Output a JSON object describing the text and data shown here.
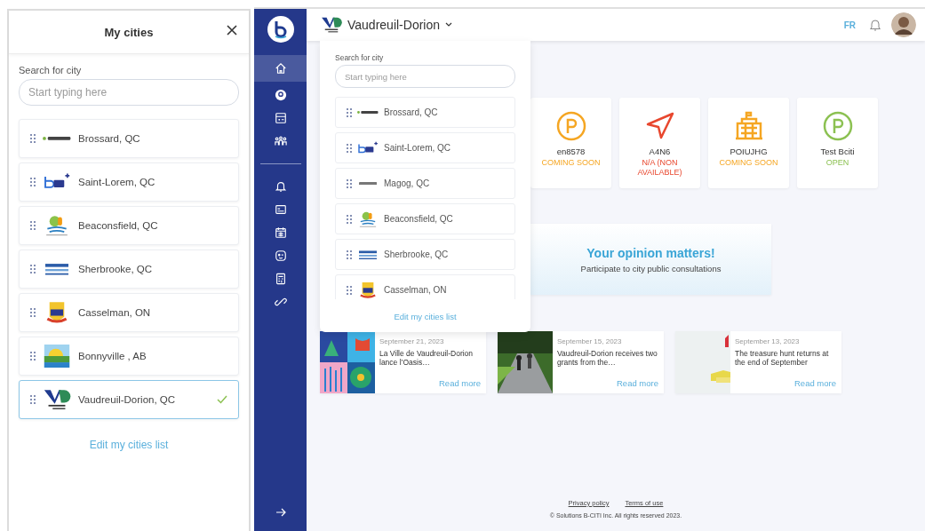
{
  "city_panel": {
    "title": "My cities",
    "search": {
      "label": "Search for city",
      "placeholder": "Start typing here"
    },
    "cities": [
      {
        "name": "Brossard, QC",
        "kind": "wordmark",
        "selected": false
      },
      {
        "name": "Saint-Lorem, QC",
        "kind": "monogram",
        "selected": false
      },
      {
        "name": "Beaconsfield, QC",
        "kind": "emblem",
        "selected": false
      },
      {
        "name": "Sherbrooke, QC",
        "kind": "banner",
        "selected": false
      },
      {
        "name": "Casselman, ON",
        "kind": "crest",
        "selected": false
      },
      {
        "name": "Bonnyville , AB",
        "kind": "landscape",
        "selected": false
      },
      {
        "name": "Vaudreuil-Dorion, QC",
        "kind": "chevron",
        "selected": true
      }
    ],
    "edit_link": "Edit my cities list"
  },
  "sidebar": {
    "items": [
      {
        "kind": "home",
        "selected": true
      },
      {
        "kind": "bubble",
        "selected": false
      },
      {
        "kind": "ticket",
        "selected": false
      },
      {
        "kind": "people",
        "selected": false
      }
    ],
    "more_items": [
      {
        "kind": "bell",
        "selected": false
      },
      {
        "kind": "news",
        "selected": false
      },
      {
        "kind": "calendar",
        "selected": false
      },
      {
        "kind": "face",
        "selected": false
      },
      {
        "kind": "document",
        "selected": false
      },
      {
        "kind": "link",
        "selected": false
      }
    ]
  },
  "header": {
    "city": "Vaudreuil-Dorion",
    "kind": "chevron",
    "language": "FR"
  },
  "city_dropdown": {
    "search": {
      "label": "Search for city",
      "placeholder": "Start typing here"
    },
    "cities": [
      {
        "name": "Brossard, QC",
        "kind": "wordmark"
      },
      {
        "name": "Saint-Lorem, QC",
        "kind": "monogram"
      },
      {
        "name": "Magog, QC",
        "kind": "greymark"
      },
      {
        "name": "Beaconsfield, QC",
        "kind": "emblem"
      },
      {
        "name": "Sherbrooke, QC",
        "kind": "banner"
      },
      {
        "name": "Casselman, ON",
        "kind": "crest"
      }
    ],
    "edit_link": "Edit my cities list"
  },
  "services": [
    {
      "kind": "parking",
      "name": "en8578",
      "status": "COMING SOON",
      "color": "#f5a623"
    },
    {
      "kind": "navigation",
      "name": "A4N6",
      "status": "N/A (NON AVAILABLE)",
      "color": "#e8472e"
    },
    {
      "kind": "building",
      "name": "POIUJHG",
      "status": "COMING SOON",
      "color": "#f5a623"
    },
    {
      "kind": "parking",
      "name": "Test Bciti",
      "status": "OPEN",
      "color": "#8cc152"
    }
  ],
  "banner": {
    "title": "Your opinion matters!",
    "text": "Participate to city public consultations"
  },
  "news": [
    {
      "date": "September 21, 2023",
      "title": "La Ville de Vaudreuil-Dorion lance l’Oasis…",
      "link": "Read more"
    },
    {
      "date": "September 15, 2023",
      "title": "Vaudreuil-Dorion receives two grants from the…",
      "link": "Read more"
    },
    {
      "date": "September 13, 2023",
      "title": "The treasure hunt returns at the end of September",
      "link": "Read more"
    }
  ],
  "footer": {
    "links": [
      "Privacy policy",
      "Terms of use"
    ],
    "copyright": "© Solutions B-CITI Inc. All rights reserved 2023."
  }
}
